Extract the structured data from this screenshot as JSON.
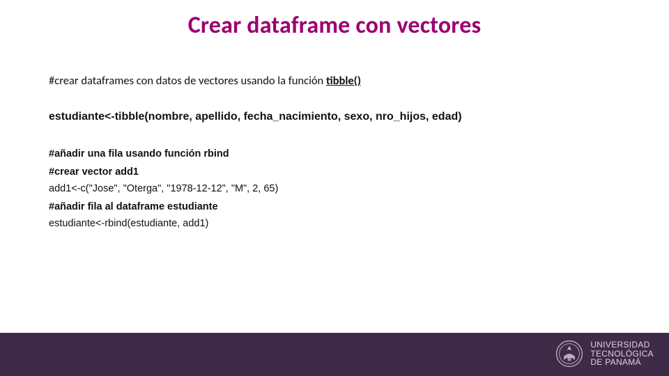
{
  "title": "Crear dataframe con vectores",
  "lines": {
    "comment1_pre": "#crear dataframes con datos de vectores usando la función ",
    "comment1_fn": "tibble()",
    "code_main": "estudiante<-tibble(nombre, apellido, fecha_nacimiento, sexo, nro_hijos, edad)",
    "comment_rbind": "#añadir una fila usando función rbind",
    "comment_add1": "#crear vector add1",
    "code_add1": "add1<-c(\"Jose\", \"Oterga\", \"1978-12-12\", \"M\", 2, 65)",
    "comment_addrow": "#añadir fila al dataframe estudiante",
    "code_rbind": "estudiante<-rbind(estudiante, add1)"
  },
  "footer": {
    "logo_l1": "UNIVERSIDAD",
    "logo_l2": "TECNOLÓGICA",
    "logo_l3": "DE PANAMÁ"
  }
}
